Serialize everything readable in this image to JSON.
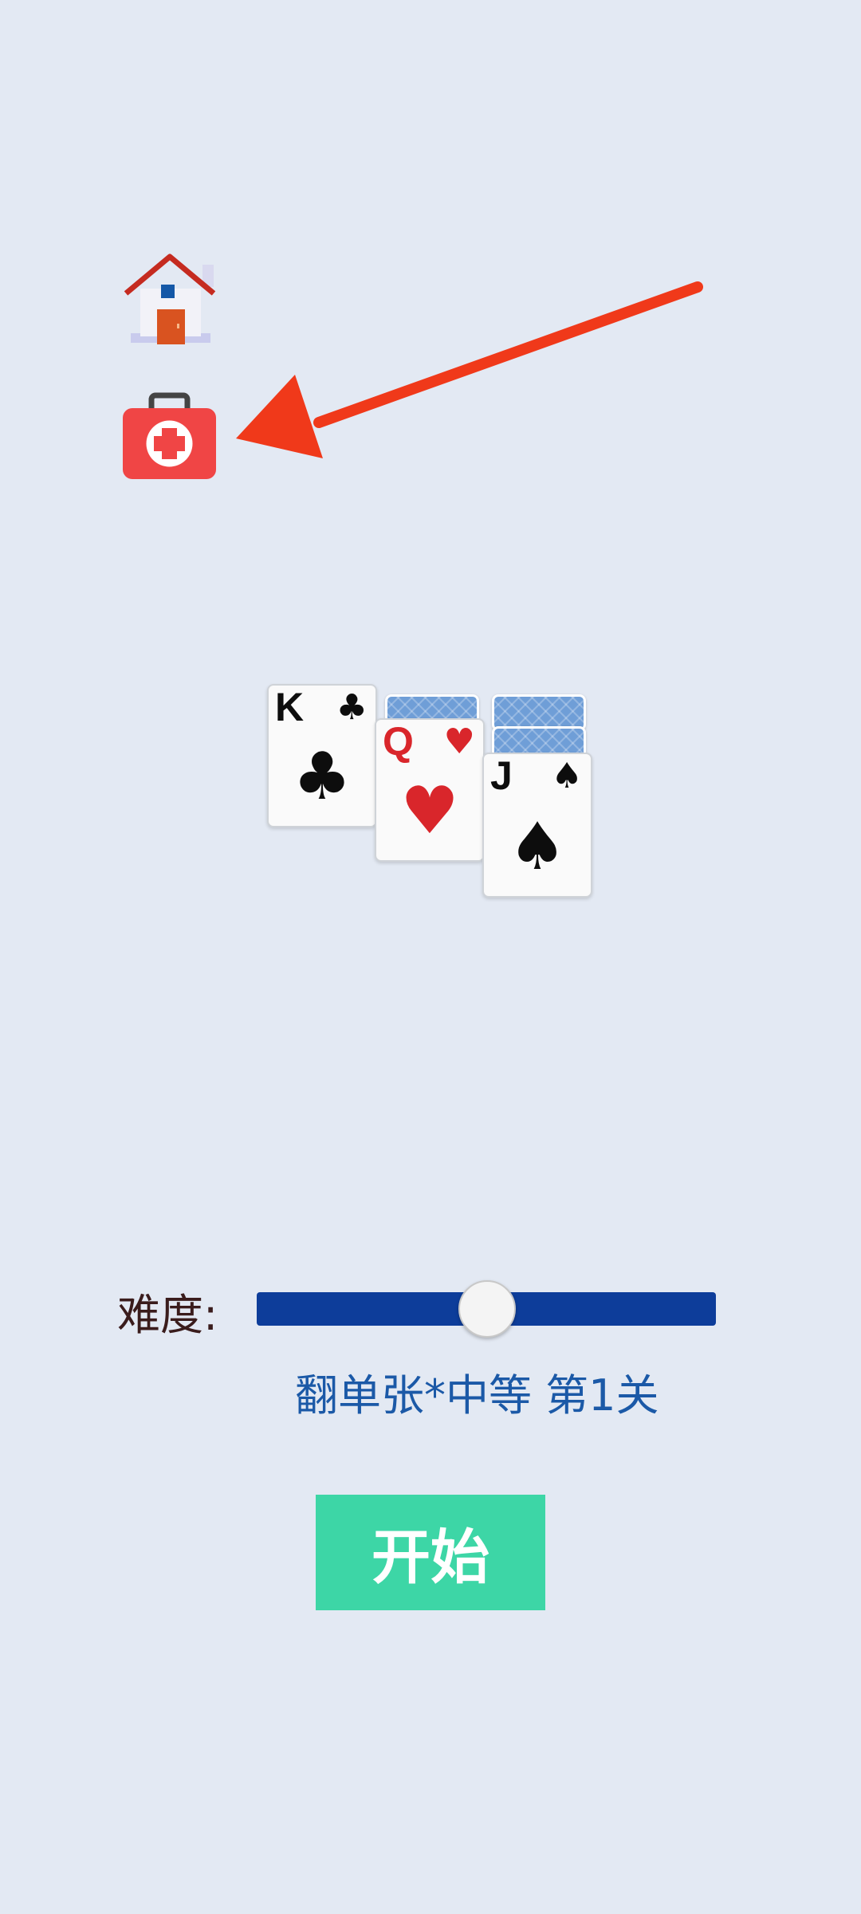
{
  "toolbar": {
    "home_icon": "home-icon",
    "first_aid_icon": "first-aid-kit-icon"
  },
  "annotation": {
    "arrow_color": "#f0391a"
  },
  "cards": {
    "king": {
      "rank": "K",
      "suit": "♣"
    },
    "queen": {
      "rank": "Q",
      "suit": "♥"
    },
    "jack": {
      "rank": "J",
      "suit": "♠"
    }
  },
  "difficulty": {
    "label": "难度:",
    "mode_text": "翻单张*中等 第1关",
    "slider_value": 0.5
  },
  "start_label": "开始",
  "colors": {
    "background": "#e3e9f3",
    "slider_track": "#0d3d9a",
    "mode_text": "#1b59a7",
    "start_button": "#3dd6a6",
    "suit_red": "#d9262b"
  }
}
